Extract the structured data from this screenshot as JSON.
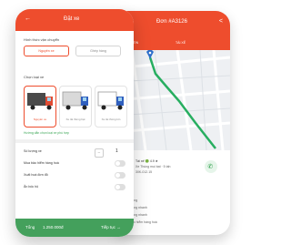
{
  "colors": {
    "accent": "#ee4d2d",
    "success": "#44a05c",
    "route": "#27ae60"
  },
  "back_screen": {
    "title": "Đơn #A3126",
    "share_icon": "share-icon",
    "tabs": [
      "THÔNG TIN",
      "TÀI XẾ"
    ],
    "driver": {
      "line1": "Tài xế 🟢 4.9 ★",
      "line2": "Xe Thùng mui bạt · 5 tấn",
      "line3": "30K-012.15"
    },
    "info_title": "Chi tiết",
    "info_lines": [
      "Giao hàng",
      "Giao hàng nhanh",
      "Giao hàng nhanh",
      "Mua bảo hiểm hàng hoá"
    ]
  },
  "front_screen": {
    "title": "Đặt xe",
    "section_transport": "Hình thức vận chuyển",
    "transport_options": [
      "Nguyên xe",
      "Ghép hàng"
    ],
    "section_vehicle": "Chọn loại xe",
    "vehicles": [
      "Nguyên xe",
      "Xe tải thùng bạt",
      "Xe tải thùng kín"
    ],
    "vehicle_note": "Hướng dẫn chọn loại xe phù hợp",
    "options": {
      "quantity_label": "Số lượng xe",
      "quantity_value": "1",
      "insurance_label": "Mua bảo hiểm hàng hoá",
      "invoice_label": "Xuất hoá đơn đỏ",
      "note_label": "Ăn bốc hộ"
    },
    "footer": {
      "total_label": "Tổng",
      "total_value": "1.250.000đ",
      "next_label": "Tiếp tục →"
    }
  }
}
